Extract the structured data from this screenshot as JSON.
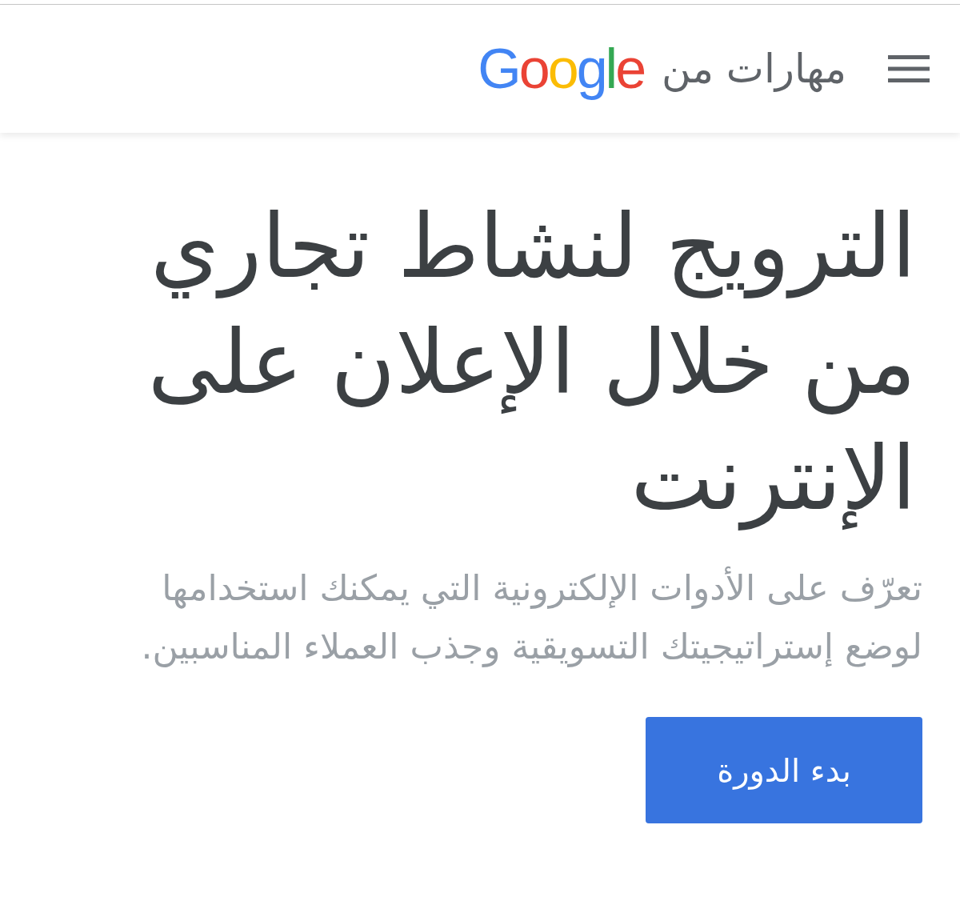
{
  "header": {
    "brand_text": "مهارات من",
    "logo": "Google"
  },
  "hero": {
    "title": "الترويج لنشاط تجاري من خلال الإعلان على الإنترنت",
    "description": "تعرّف على الأدوات الإلكترونية التي يمكنك استخدامها لوضع إستراتيجيتك التسويقية وجذب العملاء المناسبين.",
    "button": "بدء الدورة"
  }
}
